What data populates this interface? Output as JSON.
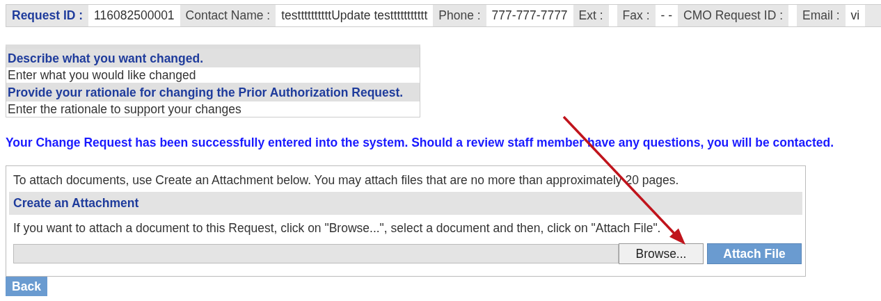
{
  "header_fields": [
    {
      "label": "Request ID :",
      "value": "116082500001",
      "kind": "primary"
    },
    {
      "label": "Contact Name :",
      "value": "testtttttttttUpdate testtttttttttt",
      "kind": "plain"
    },
    {
      "label": "Phone :",
      "value": "777-777-7777",
      "kind": "plain"
    },
    {
      "label": "Ext :",
      "kind": "plain"
    },
    {
      "label": "Fax :",
      "value": "- -",
      "kind": "plain"
    },
    {
      "label": "CMO Request ID :",
      "kind": "plain"
    },
    {
      "label": "Email :",
      "value": "vi",
      "kind": "plain"
    }
  ],
  "change_request": [
    {
      "heading": "Describe what you want changed.",
      "text": "Enter what you would like changed"
    },
    {
      "heading": "Provide your rationale for changing the Prior Authorization Request.",
      "text": "Enter the rationale to support your changes"
    }
  ],
  "success_message": "Your Change Request has been successfully entered into the system.  Should a review staff member have any questions, you will be contacted.",
  "attachment": {
    "intro": "To attach documents, use Create an Attachment below. You may attach files that are no more than approximately 20 pages.",
    "heading": "Create an Attachment",
    "instructions": "If you want to attach a document to this Request, click on \"Browse...\", select a document and then, click on \"Attach File\".",
    "browse_button": "Browse...",
    "attach_button": "Attach File"
  },
  "back_button": "Back"
}
